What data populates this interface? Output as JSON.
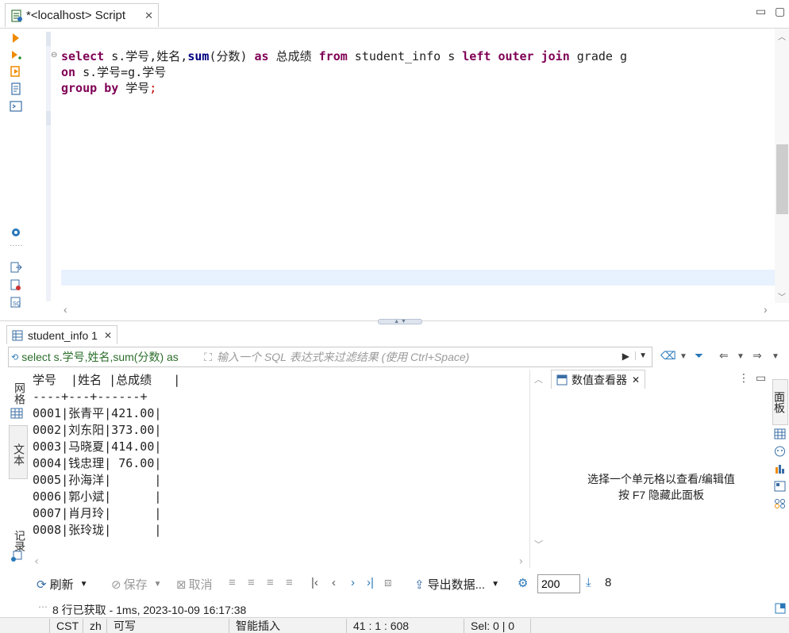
{
  "editor_tab": {
    "title": "*<localhost> Script"
  },
  "code": {
    "line1": {
      "k1": "select",
      "t1": " s.学号,姓名,",
      "f1": "sum",
      "t2": "(分数) ",
      "k2": "as",
      "t3": " 总成绩 ",
      "k3": "from",
      "t4": " student_info s ",
      "k4": "left",
      "t5": " ",
      "k5": "outer",
      "t6": " ",
      "k6": "join",
      "t7": " grade g"
    },
    "line2": {
      "k1": "on",
      "t1": " s.学号=g.学号"
    },
    "line3": {
      "k1": "group",
      "t1": " ",
      "k2": "by",
      "t2": " 学号",
      "semi": ";"
    }
  },
  "results_tab": {
    "label": "student_info 1"
  },
  "filter": {
    "sql_text": "select s.学号,姓名,sum(分数) as",
    "placeholder": "输入一个 SQL 表达式来过滤结果 (使用 Ctrl+Space)"
  },
  "left_tabs": {
    "grid": "网格",
    "text": "文本",
    "record": "记录"
  },
  "text_view": {
    "lines": [
      "学号  |姓名 |总成绩   |",
      "----+---+------+",
      "0001|张青平|421.00|",
      "0002|刘东阳|373.00|",
      "0003|马晓夏|414.00|",
      "0004|钱忠理| 76.00|",
      "0005|孙海洋|      |",
      "0006|郭小斌|      |",
      "0007|肖月玲|      |",
      "0008|张玲珑|      |"
    ]
  },
  "viewer": {
    "tab_label": "数值查看器",
    "msg_line1": "选择一个单元格以查看/编辑值",
    "msg_line2": "按 F7 隐藏此面板"
  },
  "right_tabs": {
    "panels": "面板"
  },
  "toolbar": {
    "refresh": "刷新",
    "save": "保存",
    "cancel": "取消",
    "export": "导出数据...",
    "fetch_size": "200",
    "row_count": "8"
  },
  "fetch_status": "8 行已获取 - 1ms, 2023-10-09 16:17:38",
  "statusbar": {
    "timezone": "CST",
    "locale": "zh",
    "mode": "可写",
    "insert_mode": "智能插入",
    "position": "41 : 1 : 608",
    "selection": "Sel: 0 | 0"
  },
  "colors": {
    "keyword": "#7f0055",
    "function": "#000080",
    "accent": "#3a6ea5",
    "current_line": "#e8f2fe"
  }
}
